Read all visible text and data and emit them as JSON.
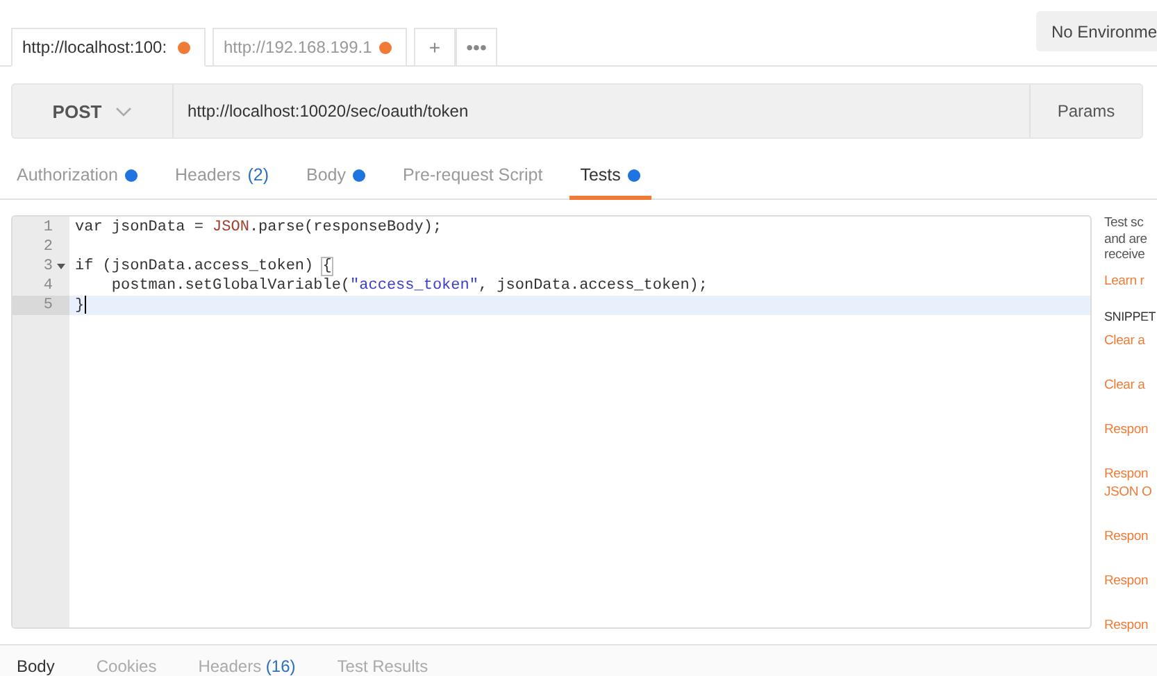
{
  "request_tabs": [
    {
      "label": "http://localhost:100:",
      "selected": true,
      "unsaved": true
    },
    {
      "label": "http://192.168.199.1",
      "selected": false,
      "unsaved": true
    }
  ],
  "tab_actions": {
    "add": "+",
    "more": "•••"
  },
  "environment": "No Environme",
  "request": {
    "method": "POST",
    "url": "http://localhost:10020/sec/oauth/token",
    "params": "Params"
  },
  "section_tabs": [
    {
      "label": "Authorization",
      "dot": true,
      "selected": false
    },
    {
      "label": "Headers",
      "count": "(2)",
      "dot": false,
      "selected": false
    },
    {
      "label": "Body",
      "dot": true,
      "selected": false
    },
    {
      "label": "Pre-request Script",
      "dot": false,
      "selected": false
    },
    {
      "label": "Tests",
      "dot": true,
      "selected": true
    }
  ],
  "editor": {
    "lines": [
      {
        "number": "1",
        "fold": false,
        "active": false,
        "tokens": [
          {
            "kind": "plain",
            "text": "var jsonData = "
          },
          {
            "kind": "builtin",
            "text": "JSON"
          },
          {
            "kind": "plain",
            "text": ".parse(responseBody);"
          }
        ]
      },
      {
        "number": "2",
        "fold": false,
        "active": false
      },
      {
        "number": "3",
        "fold": true,
        "active": false,
        "tokens": [
          {
            "kind": "plain",
            "text": "if (jsonData.access_token) "
          },
          {
            "kind": "bracket",
            "text": "{"
          }
        ]
      },
      {
        "number": "4",
        "fold": false,
        "active": false,
        "tokens": [
          {
            "kind": "plain",
            "text": "    postman.setGlobalVariable("
          },
          {
            "kind": "string",
            "text": "\"access_token\""
          },
          {
            "kind": "plain",
            "text": ", jsonData.access_token);"
          }
        ]
      },
      {
        "number": "5",
        "fold": false,
        "active": true,
        "tokens": [
          {
            "kind": "plain",
            "text": "}"
          }
        ]
      }
    ]
  },
  "help": {
    "description": [
      "Test sc",
      "and are",
      "receive"
    ],
    "learn_more": "Learn r",
    "snippets_heading": "SNIPPET",
    "snippets": [
      [
        "Clear a"
      ],
      [
        "Clear a"
      ],
      [
        "Respon"
      ],
      [
        "Respon",
        "JSON O"
      ],
      [
        "Respon"
      ],
      [
        "Respon"
      ],
      [
        "Respon"
      ]
    ]
  },
  "response_tabs": [
    {
      "label": "Body",
      "selected": true
    },
    {
      "label": "Cookies",
      "selected": false
    },
    {
      "label": "Headers",
      "count": "(16)",
      "selected": false
    },
    {
      "label": "Test Results",
      "selected": false
    }
  ]
}
